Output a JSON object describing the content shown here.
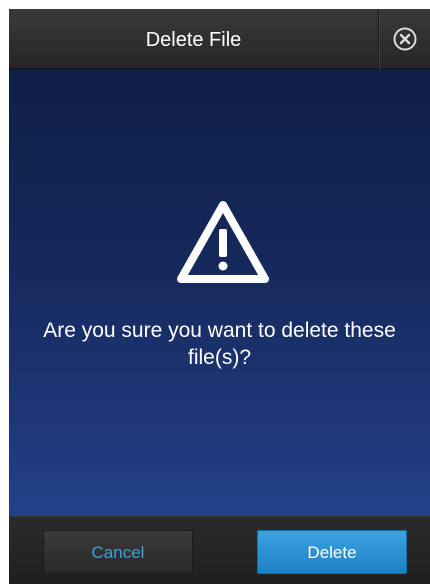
{
  "dialog": {
    "title": "Delete File",
    "message": "Are you sure you want to delete these file(s)?",
    "icon": "warning-triangle-icon",
    "close_icon": "close-circle-icon"
  },
  "footer": {
    "cancel_label": "Cancel",
    "delete_label": "Delete"
  },
  "colors": {
    "header_bg": "#2f2f2f",
    "body_top": "#0f1f46",
    "body_bottom": "#23408a",
    "accent_blue": "#2a93d4",
    "cancel_text": "#3fa2d9"
  }
}
